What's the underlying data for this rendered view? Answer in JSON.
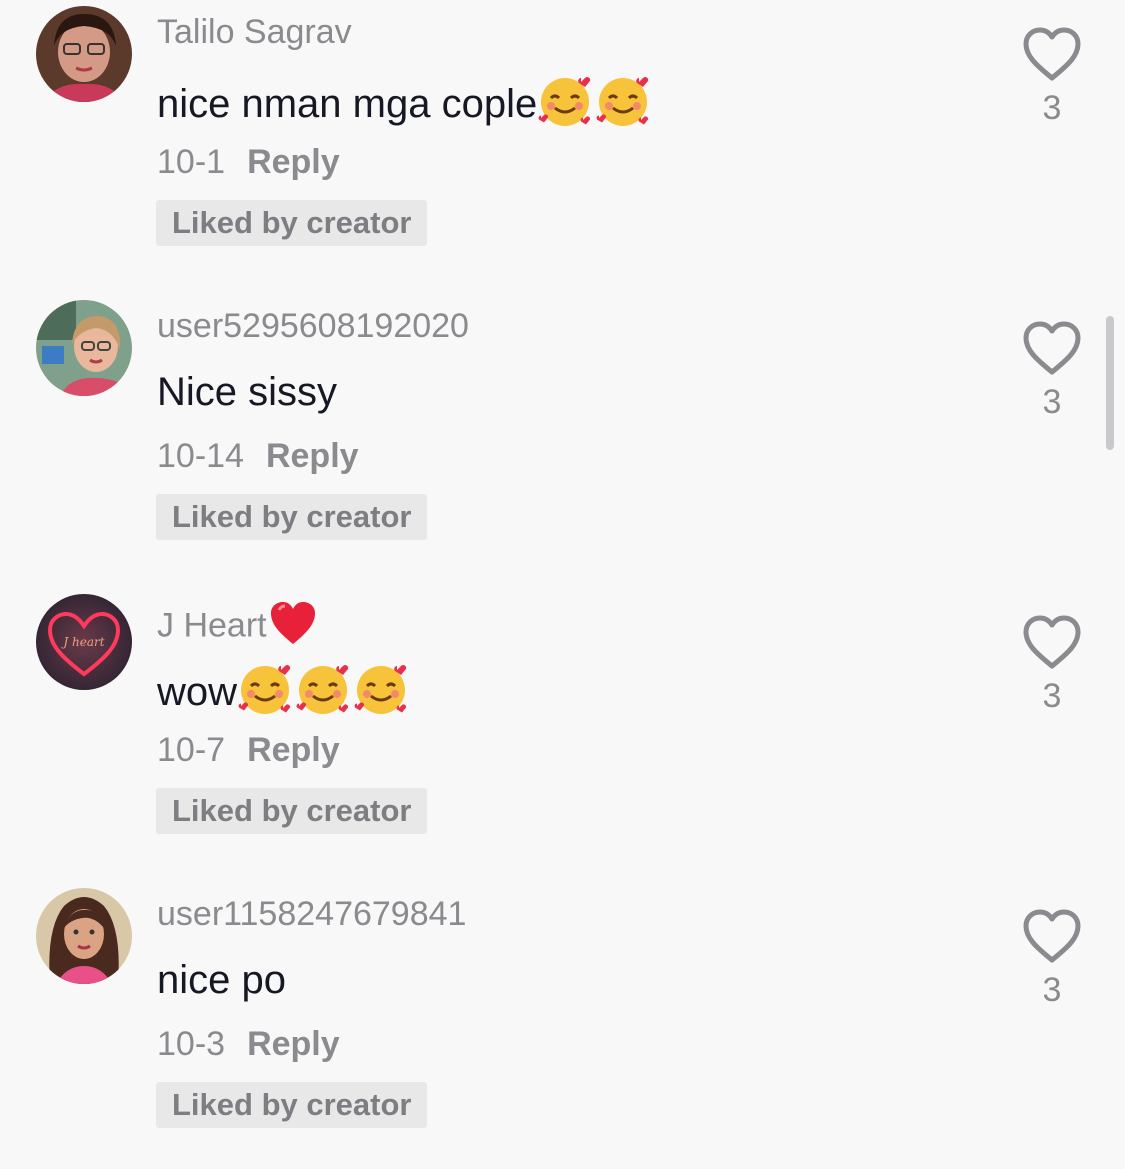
{
  "colors": {
    "background": "#f8f8f8",
    "username": "#8a8a8f",
    "text": "#161823",
    "badge_bg": "#e8e8e9",
    "heart_outline": "#8a8a8f"
  },
  "comments": [
    {
      "username": "Talilo Sagrav",
      "text": "nice nman mga cople",
      "text_emojis": [
        "smiling-face-with-hearts-emoji",
        "smiling-face-with-hearts-emoji"
      ],
      "date": "10-1",
      "reply_label": "Reply",
      "badge": "Liked by creator",
      "like_count": "3",
      "like_icon": "heart-outline-icon"
    },
    {
      "username": "user5295608192020",
      "text": "Nice sissy",
      "date": "10-14",
      "reply_label": "Reply",
      "badge": "Liked by creator",
      "like_count": "3",
      "like_icon": "heart-outline-icon"
    },
    {
      "username": "J Heart",
      "username_emoji": "red-heart-emoji",
      "text": "wow",
      "text_emojis": [
        "smiling-face-with-hearts-emoji",
        "smiling-face-with-hearts-emoji",
        "smiling-face-with-hearts-emoji"
      ],
      "date": "10-7",
      "reply_label": "Reply",
      "badge": "Liked by creator",
      "like_count": "3",
      "like_icon": "heart-outline-icon",
      "avatar_text": "J heart"
    },
    {
      "username": "user1158247679841",
      "text": "nice po",
      "date": "10-3",
      "reply_label": "Reply",
      "badge": "Liked by creator",
      "like_count": "3",
      "like_icon": "heart-outline-icon"
    }
  ]
}
